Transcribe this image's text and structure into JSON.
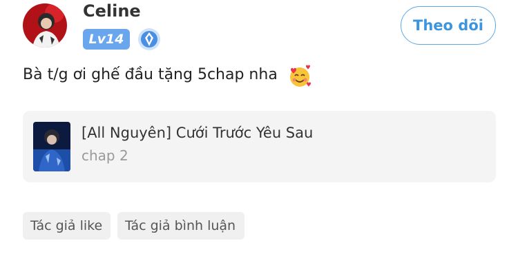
{
  "user": {
    "name": "Celine",
    "level": "Lv14",
    "follow_label": "Theo dõi",
    "avatar_icon": "user-avatar-photo",
    "rank_icon": "blue-rank-medal-icon"
  },
  "comment": {
    "text": "Bà t/g ơi ghế đầu tặng 5chap nha",
    "emoji_icon": "smiling-face-with-hearts-icon"
  },
  "story_card": {
    "title": "[All Nguyên] Cưới Trước Yêu Sau",
    "chapter": "chap 2",
    "cover_icon": "story-cover-image"
  },
  "tags": [
    {
      "label": "Tác giả like"
    },
    {
      "label": "Tác giả bình luận"
    }
  ],
  "colors": {
    "accent": "#3d95dd",
    "level_badge": "#6aa6ee",
    "card_bg": "#f4f4f4",
    "tag_bg": "#f0f0f0"
  }
}
